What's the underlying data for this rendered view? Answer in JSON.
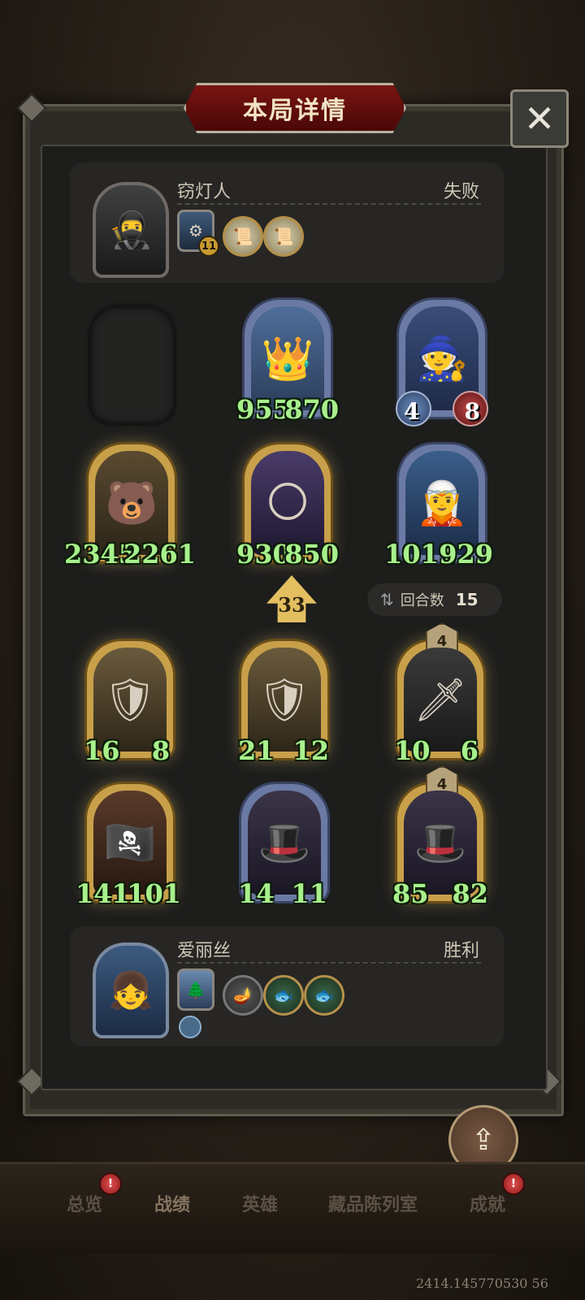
{
  "title": "本局详情",
  "close_icon": "close-icon",
  "opponent": {
    "name": "窃灯人",
    "result": "失败",
    "portrait_icon": "hooded-assassin-portrait",
    "items": [
      {
        "icon": "hero-power-icon",
        "badge": "11"
      },
      {
        "icon": "scroll-coin-icon"
      },
      {
        "icon": "scroll-coin-icon"
      }
    ],
    "board": [
      {
        "slot": "empty"
      },
      {
        "frame": "blue",
        "art": "bearded-king",
        "atk": "955",
        "hp": "870",
        "style": "green"
      },
      {
        "frame": "blue",
        "art": "starry-witch",
        "atk": "4",
        "hp": "8",
        "style": "orb"
      },
      {
        "frame": "gold",
        "art": "bear-mech",
        "atk": "2345",
        "hp": "2261",
        "style": "green"
      },
      {
        "frame": "gold",
        "art": "moon-priest",
        "atk": "930",
        "hp": "850",
        "style": "green"
      },
      {
        "frame": "blue",
        "art": "blue-hair-elf",
        "atk": "1011",
        "hp": "929",
        "style": "green"
      }
    ]
  },
  "damage": "33",
  "round": {
    "label": "回合数",
    "value": "15"
  },
  "player": {
    "name": "爱丽丝",
    "result": "胜利",
    "portrait_icon": "alice-portrait",
    "items": [
      {
        "icon": "hero-power-icon"
      },
      {
        "icon": "lamp-icon"
      },
      {
        "icon": "green-fish-coin-icon"
      },
      {
        "icon": "green-fish-coin-icon"
      }
    ],
    "board": [
      {
        "frame": "gold",
        "art": "crusader-knight",
        "atk": "16",
        "hp": "8",
        "style": "green"
      },
      {
        "frame": "gold",
        "art": "crusader-knight",
        "atk": "21",
        "hp": "12",
        "style": "green"
      },
      {
        "frame": "gold",
        "art": "shield-guard",
        "atk": "10",
        "hp": "6",
        "style": "green",
        "tier": "4"
      },
      {
        "frame": "gold",
        "art": "pirate-girl",
        "atk": "141",
        "hp": "101",
        "style": "green"
      },
      {
        "frame": "blue",
        "art": "masked-gunslinger",
        "atk": "14",
        "hp": "11",
        "style": "green"
      },
      {
        "frame": "gold",
        "art": "masked-gunslinger",
        "atk": "85",
        "hp": "82",
        "style": "green",
        "tier": "4"
      }
    ]
  },
  "share_label": "分享",
  "nav": [
    {
      "label": "总览",
      "badge": "!"
    },
    {
      "label": "战绩"
    },
    {
      "label": "英雄"
    },
    {
      "label": "藏品陈列室"
    },
    {
      "label": "成就",
      "badge": "!"
    }
  ],
  "footer_id": "2414.145770530 56"
}
